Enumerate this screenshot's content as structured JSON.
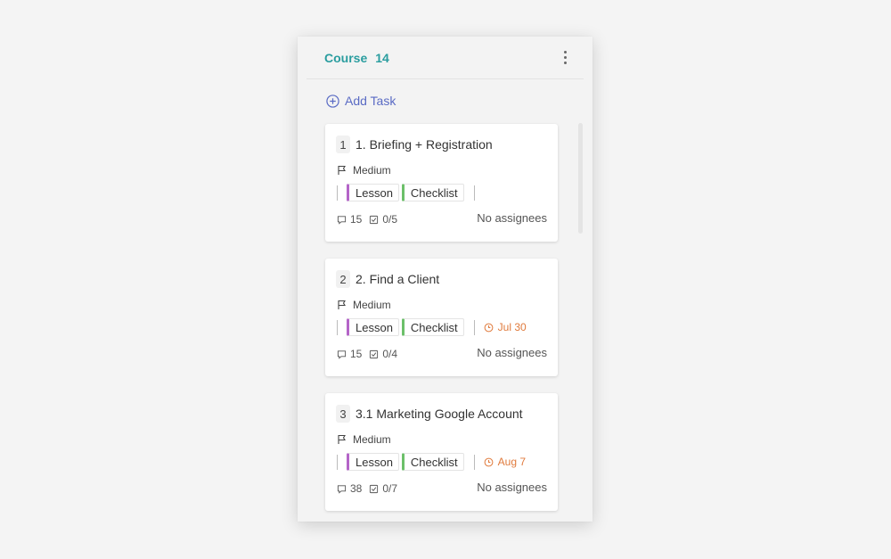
{
  "column": {
    "title": "Course",
    "count": "14",
    "add_task_label": "Add Task"
  },
  "cards": [
    {
      "number": "1",
      "title": "1. Briefing + Registration",
      "priority": "Medium",
      "tags": [
        "Lesson",
        "Checklist"
      ],
      "due": "",
      "comments": "15",
      "checklist": "0/5",
      "assignees": "No assignees"
    },
    {
      "number": "2",
      "title": "2. Find a Client",
      "priority": "Medium",
      "tags": [
        "Lesson",
        "Checklist"
      ],
      "due": "Jul 30",
      "comments": "15",
      "checklist": "0/4",
      "assignees": "No assignees"
    },
    {
      "number": "3",
      "title": "3.1 Marketing Google Account",
      "priority": "Medium",
      "tags": [
        "Lesson",
        "Checklist"
      ],
      "due": "Aug 7",
      "comments": "38",
      "checklist": "0/7",
      "assignees": "No assignees"
    }
  ],
  "colors": {
    "title_accent": "#2a9d9f",
    "add_task": "#5a6bc4",
    "lesson_tag": "#b464c8",
    "checklist_tag": "#6cc06a",
    "due_date": "#e07a3c"
  }
}
